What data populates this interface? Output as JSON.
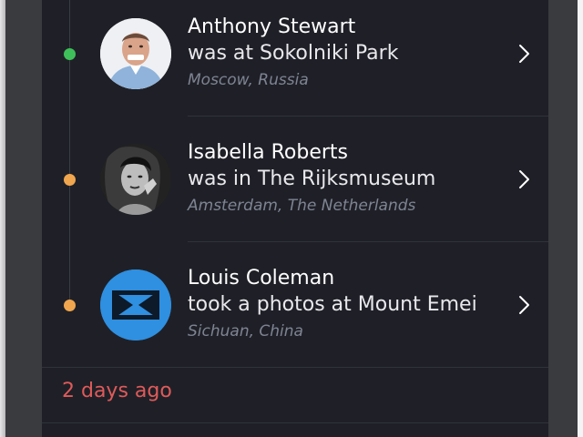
{
  "feed": {
    "items": [
      {
        "name": "Anthony Stewart",
        "action": "was at Sokolniki Park",
        "location": "Moscow, Russia",
        "dot_color": "#3fbf5a",
        "avatar_icon": "person-photo"
      },
      {
        "name": "Isabella Roberts",
        "action": "was in The Rijksmuseum",
        "location": "Amsterdam, The Netherlands",
        "dot_color": "#f0a64e",
        "avatar_icon": "person-photo"
      },
      {
        "name": "Louis Coleman",
        "action": "took a photos at Mount Emei",
        "location": "Sichuan, China",
        "dot_color": "#f0a64e",
        "avatar_icon": "bowtie-logo"
      }
    ],
    "day_label": "2 days ago"
  },
  "colors": {
    "background": "#1f2027",
    "accent_date": "#e05a5a",
    "logo_blue": "#2f8fe0"
  }
}
